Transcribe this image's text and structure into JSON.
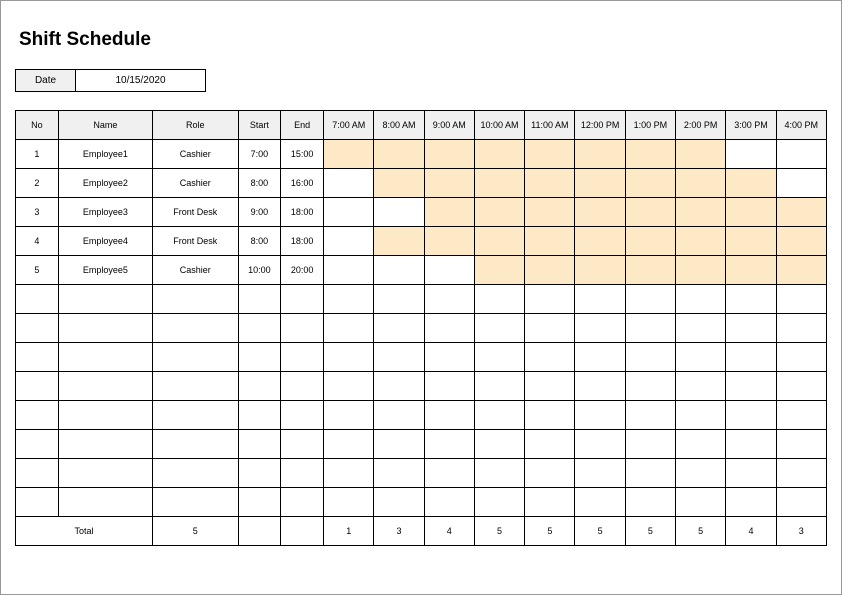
{
  "title": "Shift Schedule",
  "date_label": "Date",
  "date_value": "10/15/2020",
  "headers": {
    "no": "No",
    "name": "Name",
    "role": "Role",
    "start": "Start",
    "end": "End"
  },
  "hours": [
    "7:00 AM",
    "8:00 AM",
    "9:00 AM",
    "10:00 AM",
    "11:00 AM",
    "12:00 PM",
    "1:00 PM",
    "2:00 PM",
    "3:00 PM",
    "4:00 PM"
  ],
  "employees": [
    {
      "no": "1",
      "name": "Employee1",
      "role": "Cashier",
      "start": "7:00",
      "end": "15:00",
      "start_idx": 0,
      "end_idx": 8
    },
    {
      "no": "2",
      "name": "Employee2",
      "role": "Cashier",
      "start": "8:00",
      "end": "16:00",
      "start_idx": 1,
      "end_idx": 9
    },
    {
      "no": "3",
      "name": "Employee3",
      "role": "Front Desk",
      "start": "9:00",
      "end": "18:00",
      "start_idx": 2,
      "end_idx": 10
    },
    {
      "no": "4",
      "name": "Employee4",
      "role": "Front Desk",
      "start": "8:00",
      "end": "18:00",
      "start_idx": 1,
      "end_idx": 10
    },
    {
      "no": "5",
      "name": "Employee5",
      "role": "Cashier",
      "start": "10:00",
      "end": "20:00",
      "start_idx": 3,
      "end_idx": 10
    }
  ],
  "empty_rows": 8,
  "total_label": "Total",
  "total_count": "5",
  "totals": [
    "1",
    "3",
    "4",
    "5",
    "5",
    "5",
    "5",
    "5",
    "4",
    "3"
  ]
}
